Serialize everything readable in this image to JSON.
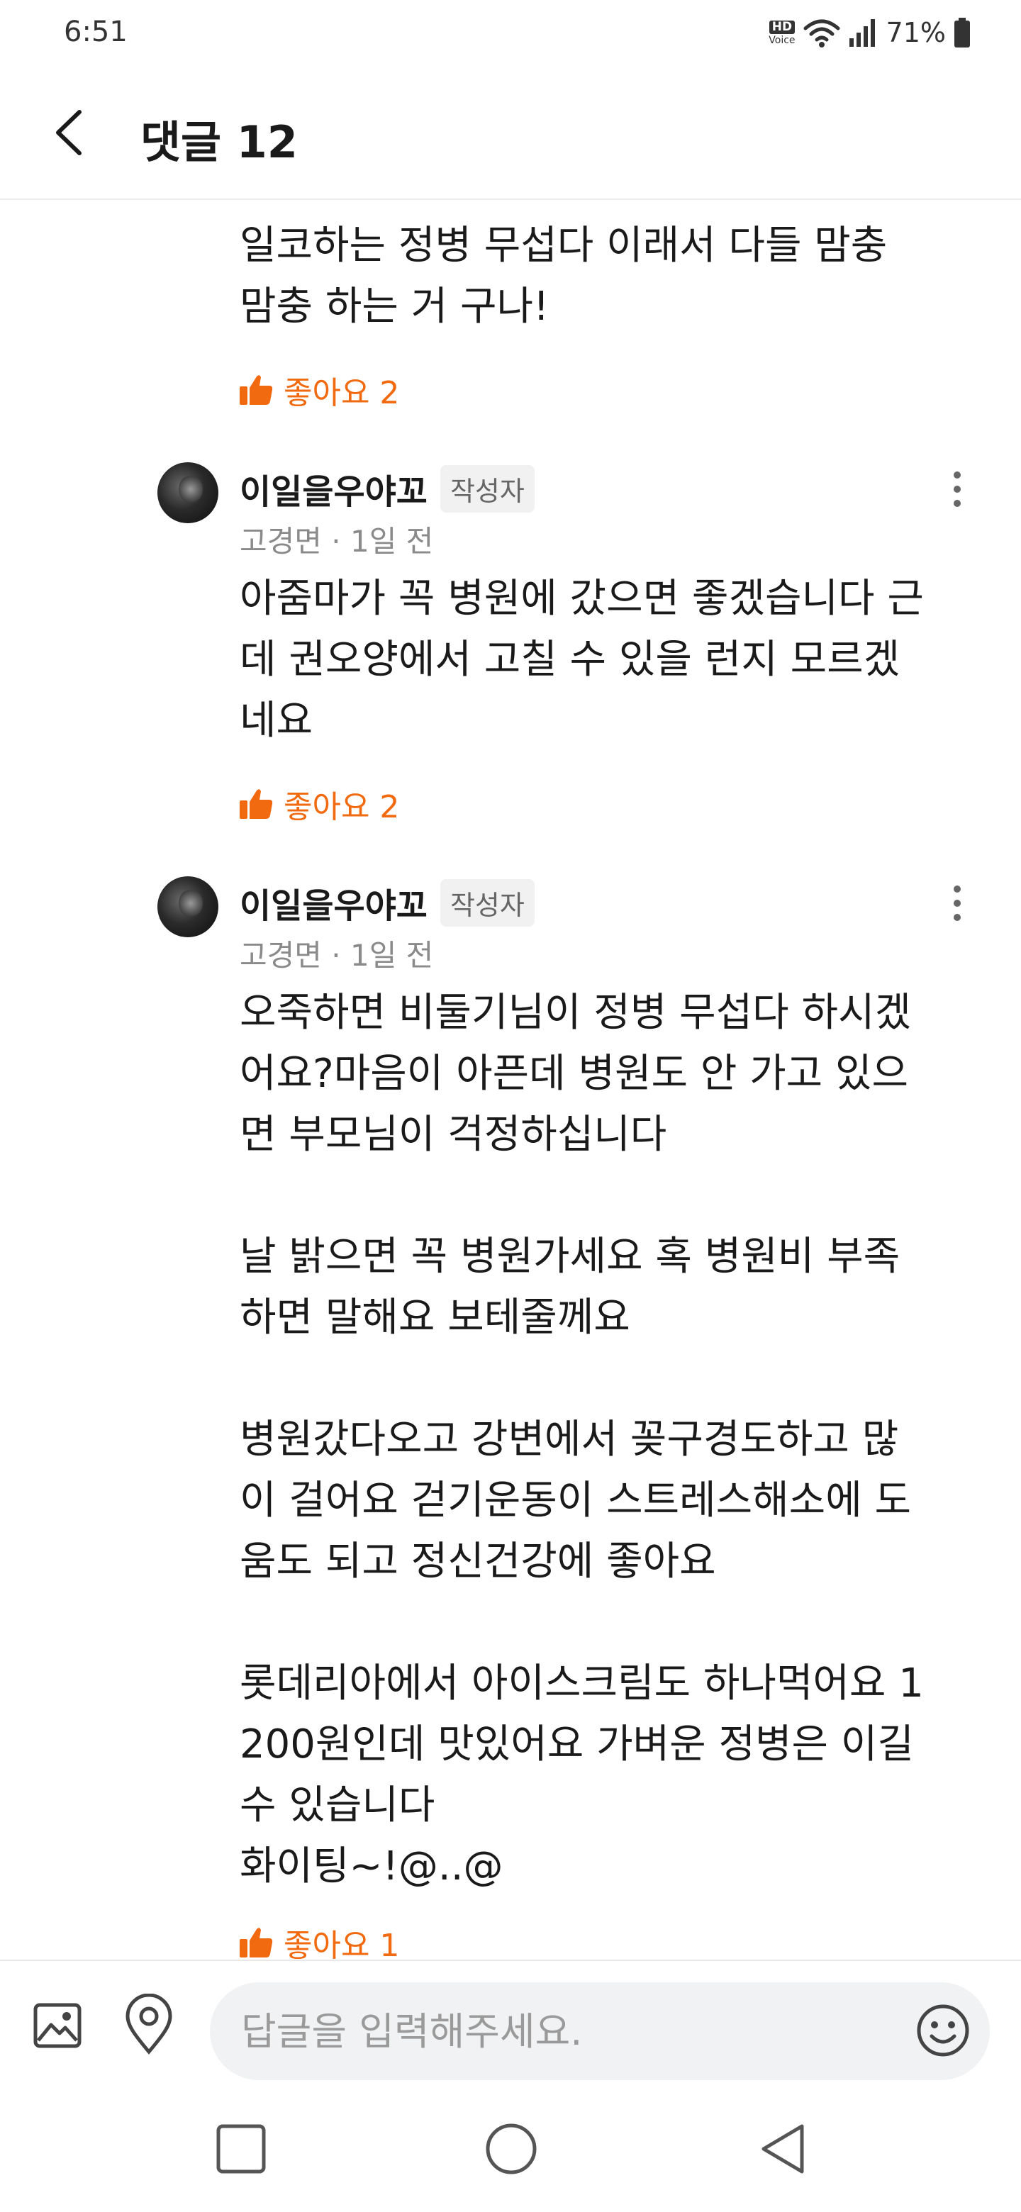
{
  "status_bar": {
    "time": "6:51",
    "hd_label": "HD",
    "voice_label": "Voice",
    "battery": "71%"
  },
  "header": {
    "title": "댓글 12"
  },
  "comments": [
    {
      "text": "일코하는 정병 무섭다 이래서 다들 맘충\n맘충 하는 거 구나!",
      "like_label": "좋아요 2"
    },
    {
      "author": "이일을우야꼬",
      "badge": "작성자",
      "meta": "고경면 · 1일 전",
      "text": "아줌마가 꼭 병원에 갔으면 좋겠습니다 근\n데 권오양에서 고칠 수 있을 런지 모르겠\n네요",
      "like_label": "좋아요 2"
    },
    {
      "author": "이일을우야꼬",
      "badge": "작성자",
      "meta": "고경면 · 1일 전",
      "text": "오죽하면 비둘기님이 정병 무섭다 하시겠\n어요?마음이 아픈데 병원도 안 가고 있으\n면 부모님이 걱정하십니다\n\n날 밝으면 꼭 병원가세요 혹 병원비 부족\n하면 말해요 보테줄께요\n\n병원갔다오고 강변에서 꽂구경도하고 많\n이 걸어요 걷기운동이 스트레스해소에 도\n움도 되고 정신건강에 좋아요\n\n롯데리아에서 아이스크림도 하나먹어요 1\n200원인데 맛있어요 가벼운 정병은 이길\n수 있습니다\n화이팅~!@..@",
      "like_label": "좋아요 1"
    }
  ],
  "reply_bar": {
    "placeholder": "답글을 입력해주세요."
  },
  "colors": {
    "accent": "#f26a0f",
    "text": "#1a1a1a",
    "meta": "#8a8a8a",
    "input_bg": "#f1f2f3"
  },
  "icons": [
    "back-arrow-icon",
    "thumbs-up-icon",
    "more-vertical-icon",
    "image-icon",
    "location-pin-icon",
    "emoji-icon",
    "recent-apps-icon",
    "home-icon",
    "nav-back-icon",
    "wifi-icon",
    "signal-icon",
    "battery-icon"
  ]
}
